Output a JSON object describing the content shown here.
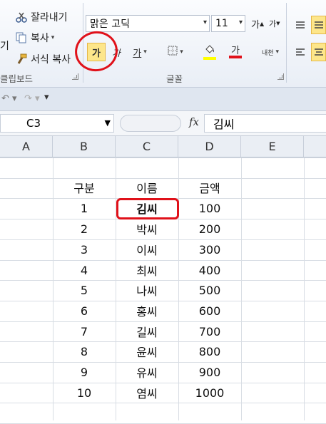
{
  "ribbon": {
    "clipboard": {
      "cut": "잘라내기",
      "copy": "복사",
      "format_painter": "서식 복사",
      "group_label": "클립보드"
    },
    "font": {
      "font_name": "맑은 고딕",
      "font_size": "11",
      "grow_glyph": "가",
      "shrink_glyph": "가",
      "bold_glyph": "가",
      "italic_glyph": "가",
      "underline_glyph": "가",
      "font_color_glyph": "가",
      "phonetic_glyph": "내천",
      "group_label": "글꼴",
      "bold_active": true
    },
    "edge_label": "기"
  },
  "namebox": {
    "value": "C3"
  },
  "formula": {
    "fx": "fx",
    "value": "김씨"
  },
  "columns": [
    "A",
    "B",
    "C",
    "D",
    "E"
  ],
  "table": {
    "headers": [
      "구분",
      "이름",
      "금액"
    ],
    "rows": [
      [
        "1",
        "김씨",
        "100"
      ],
      [
        "2",
        "박씨",
        "200"
      ],
      [
        "3",
        "이씨",
        "300"
      ],
      [
        "4",
        "최씨",
        "400"
      ],
      [
        "5",
        "나씨",
        "500"
      ],
      [
        "6",
        "홍씨",
        "600"
      ],
      [
        "7",
        "길씨",
        "700"
      ],
      [
        "8",
        "윤씨",
        "800"
      ],
      [
        "9",
        "유씨",
        "900"
      ],
      [
        "10",
        "염씨",
        "1000"
      ]
    ]
  },
  "colors": {
    "highlight_bar": "#ffff00",
    "font_color_bar": "#e0111a",
    "annotation": "#e0111a",
    "active_button": "#fde68a"
  }
}
